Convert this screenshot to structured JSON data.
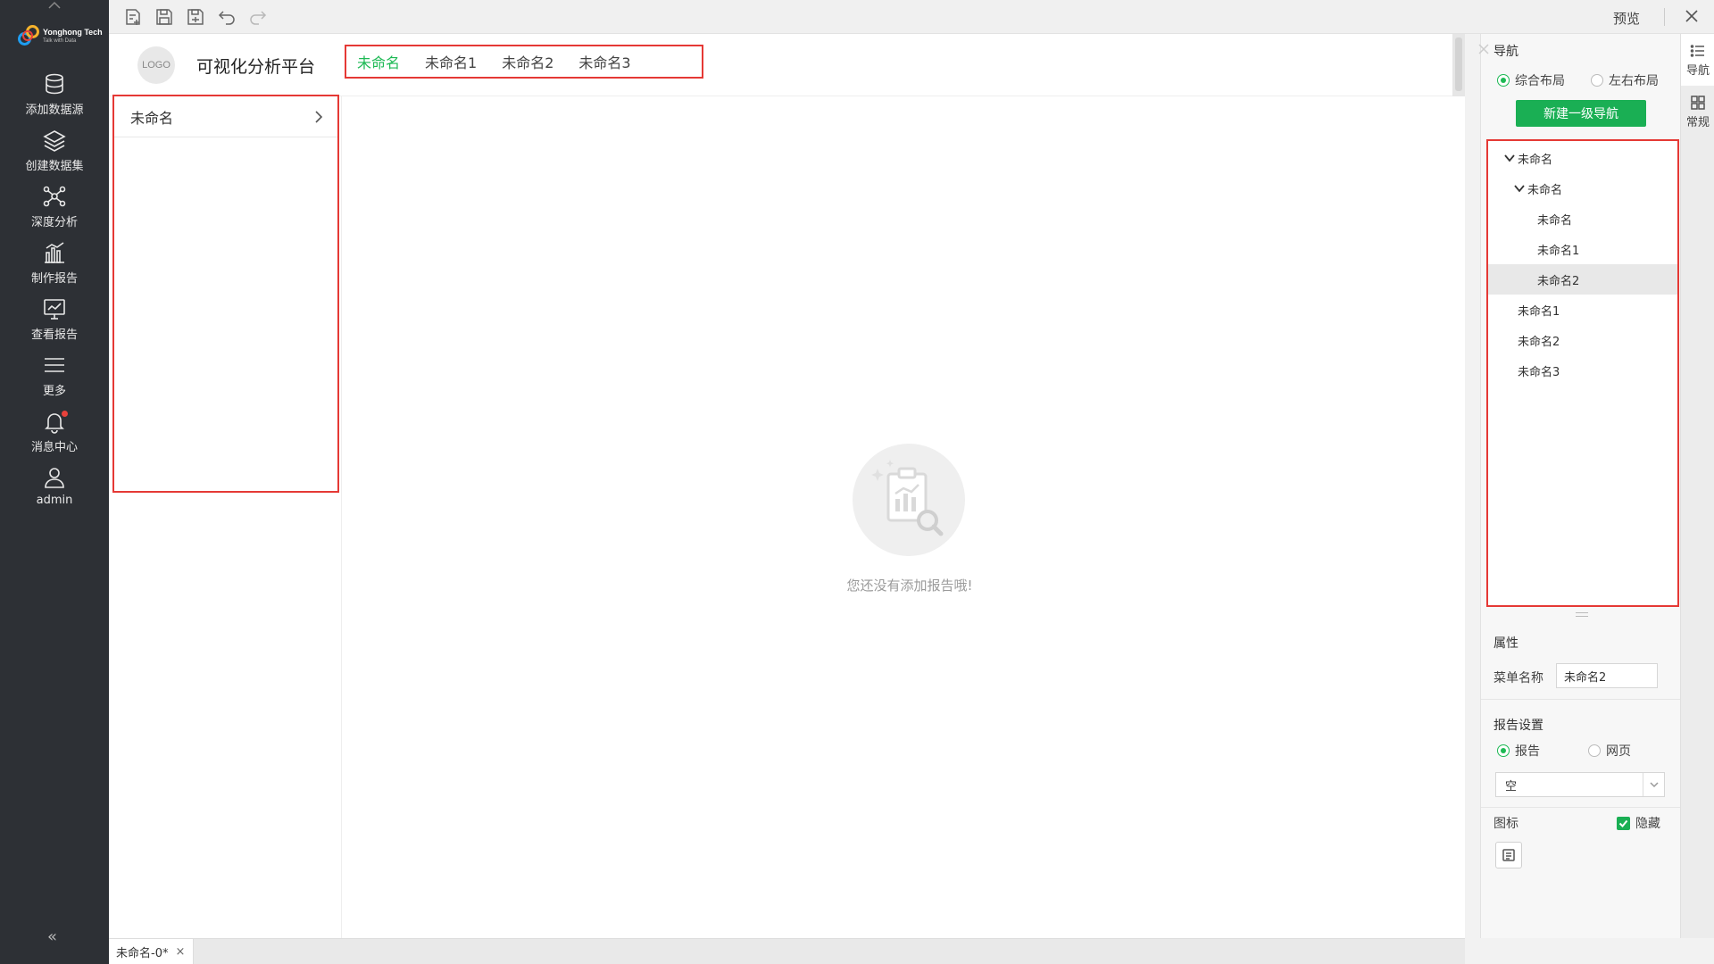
{
  "sidebar": {
    "brand": "Yonghong Tech",
    "slogan": "Talk with Data",
    "items": [
      {
        "label": "添加数据源",
        "icon": "database-icon"
      },
      {
        "label": "创建数据集",
        "icon": "layers-icon"
      },
      {
        "label": "深度分析",
        "icon": "network-icon"
      },
      {
        "label": "制作报告",
        "icon": "bar-chart-icon"
      },
      {
        "label": "查看报告",
        "icon": "monitor-chart-icon"
      },
      {
        "label": "更多",
        "icon": "menu-icon"
      },
      {
        "label": "消息中心",
        "icon": "bell-icon"
      },
      {
        "label": "admin",
        "icon": "user-icon"
      }
    ],
    "collapse_glyph": "«"
  },
  "toolbar": {
    "preview_label": "预览",
    "icons": [
      "new-doc-icon",
      "save-icon",
      "save-as-icon",
      "undo-icon",
      "redo-icon"
    ]
  },
  "canvas": {
    "logo_text": "LOGO",
    "platform_title": "可视化分析平台",
    "top_menu": [
      "未命名",
      "未命名1",
      "未命名2",
      "未命名3"
    ],
    "active_top_menu": 0,
    "side_menu": [
      "未命名"
    ],
    "empty_message": "您还没有添加报告哦!"
  },
  "bottom_tabs": [
    {
      "label": "未命名-0*",
      "close": "×"
    }
  ],
  "right_panel": {
    "nav_title": "导航",
    "layout_options": [
      "综合布局",
      "左右布局"
    ],
    "layout_selected": 0,
    "new_nav_button": "新建一级导航",
    "tree": [
      {
        "label": "未命名",
        "level": 0,
        "expanded": true
      },
      {
        "label": "未命名",
        "level": 1,
        "expanded": true
      },
      {
        "label": "未命名",
        "level": 2
      },
      {
        "label": "未命名1",
        "level": 2
      },
      {
        "label": "未命名2",
        "level": 2,
        "selected": true
      },
      {
        "label": "未命名1",
        "level": 0
      },
      {
        "label": "未命名2",
        "level": 0
      },
      {
        "label": "未命名3",
        "level": 0
      }
    ],
    "properties_title": "属性",
    "menu_name_label": "菜单名称",
    "menu_name_value": "未命名2",
    "report_settings_title": "报告设置",
    "report_type_options": [
      "报告",
      "网页"
    ],
    "report_type_selected": 0,
    "report_select_value": "空",
    "icon_label": "图标",
    "hide_label": "隐藏",
    "hide_checked": true
  },
  "vertical_tabs": [
    {
      "label": "导航",
      "icon": "list-icon",
      "active": true
    },
    {
      "label": "常规",
      "icon": "grid-icon",
      "active": false
    }
  ],
  "colors": {
    "accent_green": "#1aaf54",
    "highlight_red": "#e53935",
    "sidebar_bg": "#2d3035"
  }
}
